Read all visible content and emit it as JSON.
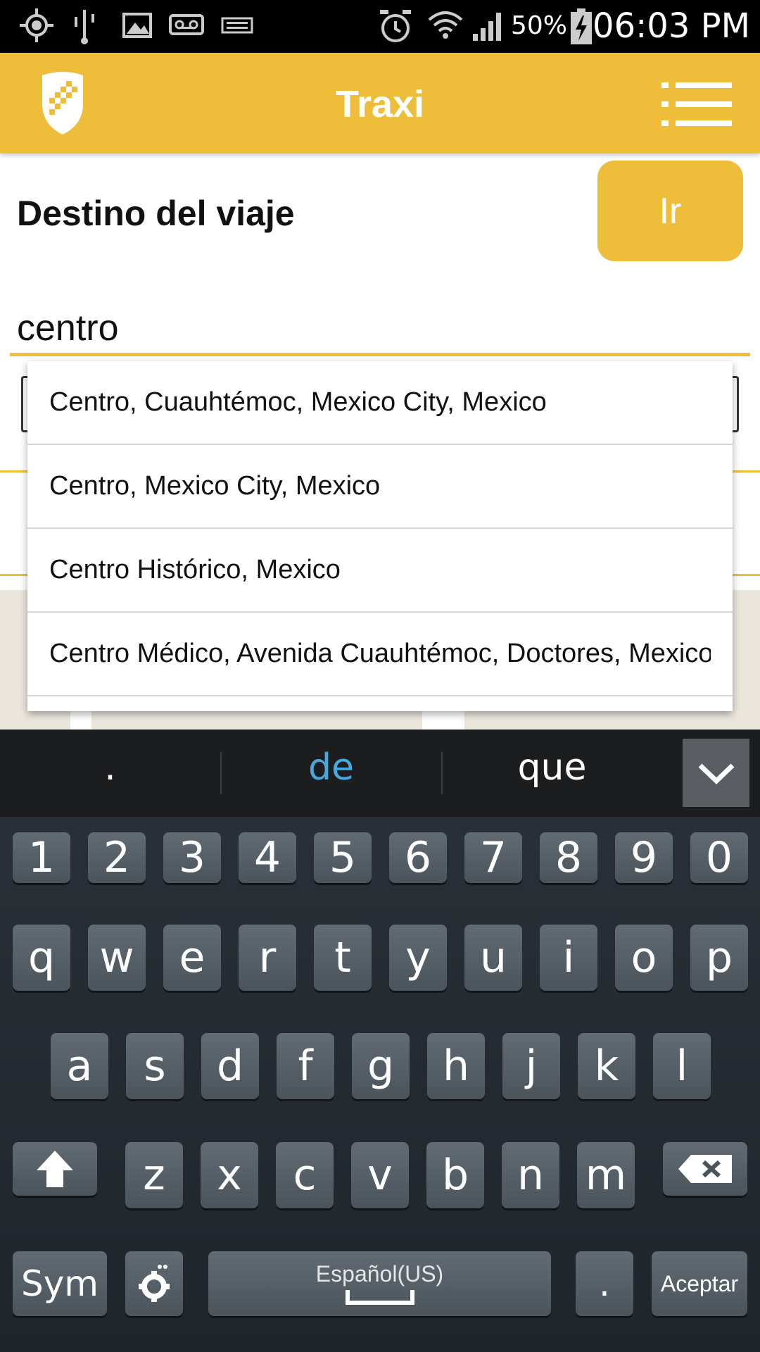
{
  "status_bar": {
    "battery_percent": "50%",
    "time": "06:03 PM",
    "icons": [
      "gps-icon",
      "usb-icon",
      "image-icon",
      "voicemail-icon",
      "keyboard-icon",
      "alarm-icon",
      "wifi-icon",
      "signal-icon",
      "battery-charging-icon"
    ]
  },
  "app_bar": {
    "title": "Traxi",
    "logo_icon": "shield-logo-icon",
    "menu_icon": "menu-icon"
  },
  "form": {
    "destination_label": "Destino del viaje",
    "go_button": "Ir",
    "search_value": "centro"
  },
  "suggestions": [
    "Centro, Cuauhtémoc, Mexico City, Mexico",
    "Centro, Mexico City, Mexico",
    "Centro Histórico, Mexico",
    "Centro Médico, Avenida Cuauhtémoc, Doctores, Mexico"
  ],
  "keyboard": {
    "predictions": [
      ".",
      "de",
      "que"
    ],
    "active_prediction": "de",
    "collapse_icon": "chevron-down-icon",
    "row_numbers": [
      "1",
      "2",
      "3",
      "4",
      "5",
      "6",
      "7",
      "8",
      "9",
      "0"
    ],
    "row1": [
      "q",
      "w",
      "e",
      "r",
      "t",
      "y",
      "u",
      "i",
      "o",
      "p"
    ],
    "row2": [
      "a",
      "s",
      "d",
      "f",
      "g",
      "h",
      "j",
      "k",
      "l"
    ],
    "row3": [
      "z",
      "x",
      "c",
      "v",
      "b",
      "n",
      "m"
    ],
    "sym_label": "Sym",
    "space_label": "Español(US)",
    "enter_label": "Aceptar",
    "period_key": "."
  },
  "colors": {
    "accent": "#eebe3b",
    "prediction_active": "#48a8e0"
  }
}
